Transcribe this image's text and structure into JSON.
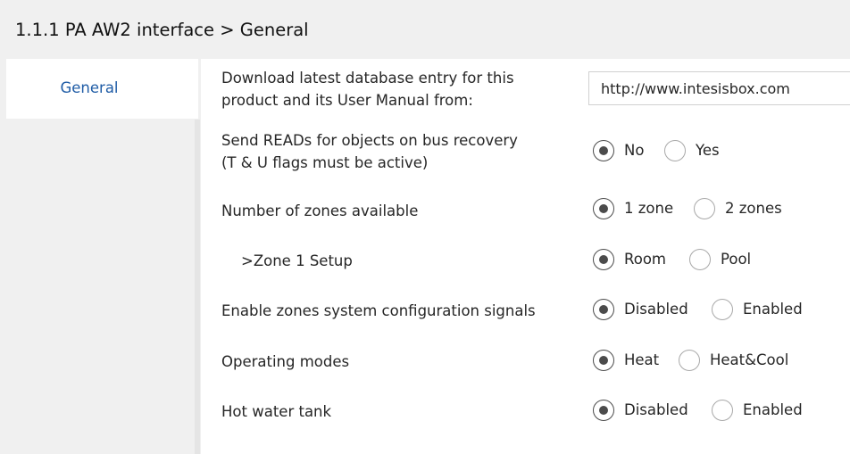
{
  "header": {
    "title": "1.1.1 PA AW2 interface > General"
  },
  "sidebar": {
    "tabs": [
      {
        "label": "General",
        "selected": true
      }
    ]
  },
  "settings": {
    "download": {
      "label_line1": "Download latest database entry for this",
      "label_line2": "product and its User Manual from:",
      "value": "http://www.intesisbox.com"
    },
    "send_reads": {
      "label_line1": "Send READs for objects on bus recovery",
      "label_line2": "(T & U flags must be active)",
      "options": [
        "No",
        "Yes"
      ],
      "selected": "No"
    },
    "zones": {
      "label": "Number of zones available",
      "options": [
        "1 zone",
        "2 zones"
      ],
      "selected": "1 zone"
    },
    "zone1_setup": {
      "label": ">Zone 1 Setup",
      "options": [
        "Room",
        "Pool"
      ],
      "selected": "Room"
    },
    "zones_config_signals": {
      "label": "Enable zones system configuration signals",
      "options": [
        "Disabled",
        "Enabled"
      ],
      "selected": "Disabled"
    },
    "operating_modes": {
      "label": "Operating modes",
      "options": [
        "Heat",
        "Heat&Cool"
      ],
      "selected": "Heat"
    },
    "hot_water_tank": {
      "label": "Hot water tank",
      "options": [
        "Disabled",
        "Enabled"
      ],
      "selected": "Disabled"
    }
  }
}
